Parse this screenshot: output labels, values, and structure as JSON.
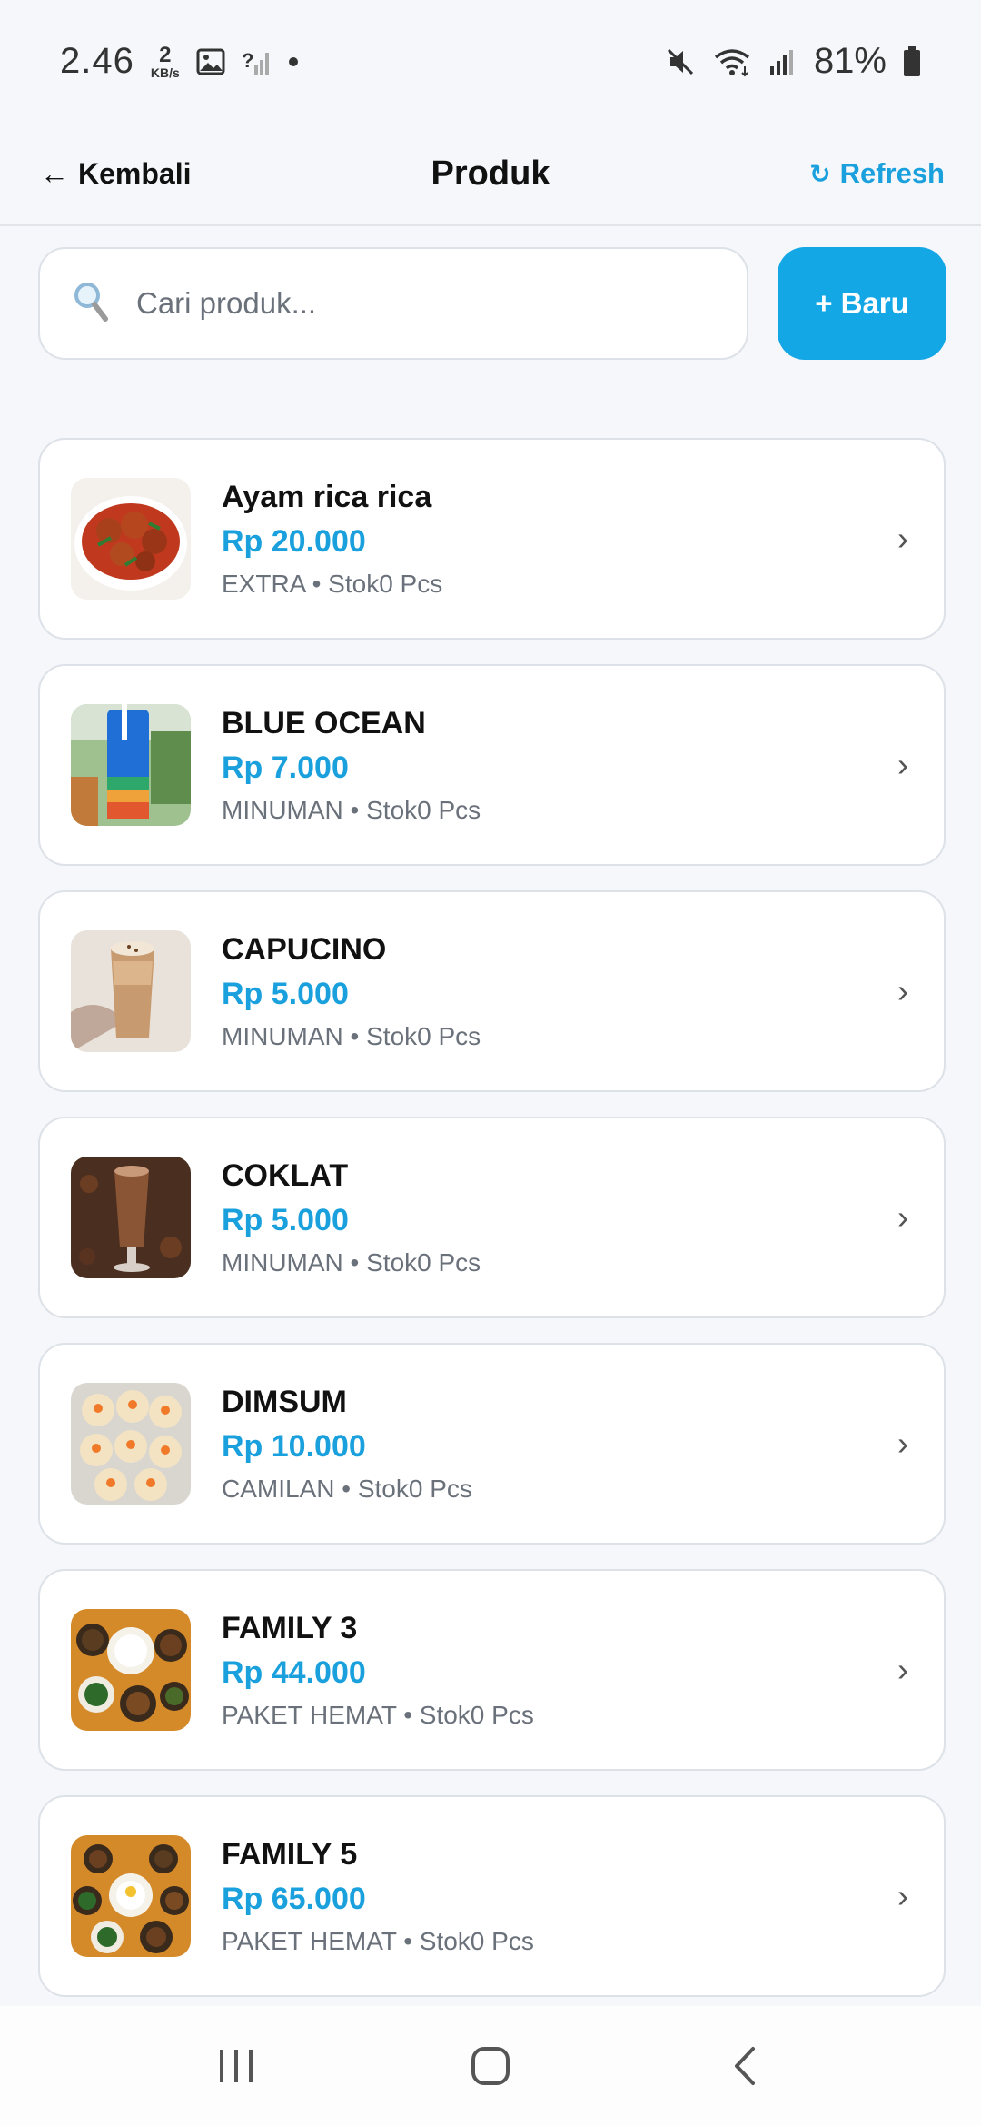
{
  "status_bar": {
    "time": "2.46",
    "net_speed_value": "2",
    "net_speed_unit": "KB/s",
    "battery": "81%"
  },
  "header": {
    "back_label": "Kembali",
    "title": "Produk",
    "refresh_label": "Refresh"
  },
  "search": {
    "placeholder": "Cari produk...",
    "value": "",
    "new_button_label": "+ Baru"
  },
  "products": [
    {
      "name": "Ayam rica rica",
      "price": "Rp 20.000",
      "meta": "EXTRA • Stok0 Pcs",
      "thumb_icon": "food-photo-ayam"
    },
    {
      "name": "BLUE OCEAN",
      "price": "Rp 7.000",
      "meta": "MINUMAN • Stok0 Pcs",
      "thumb_icon": "drink-photo-blue-ocean"
    },
    {
      "name": "CAPUCINO",
      "price": "Rp 5.000",
      "meta": "MINUMAN • Stok0 Pcs",
      "thumb_icon": "drink-photo-capucino"
    },
    {
      "name": "COKLAT",
      "price": "Rp 5.000",
      "meta": "MINUMAN • Stok0 Pcs",
      "thumb_icon": "drink-photo-coklat"
    },
    {
      "name": "DIMSUM",
      "price": "Rp 10.000",
      "meta": "CAMILAN • Stok0 Pcs",
      "thumb_icon": "food-photo-dimsum"
    },
    {
      "name": "FAMILY 3",
      "price": "Rp 44.000",
      "meta": "PAKET HEMAT • Stok0 Pcs",
      "thumb_icon": "food-photo-family-3"
    },
    {
      "name": "FAMILY 5",
      "price": "Rp 65.000",
      "meta": "PAKET HEMAT • Stok0 Pcs",
      "thumb_icon": "food-photo-family-5"
    }
  ],
  "colors": {
    "accent": "#1aa0dc",
    "button": "#14a7e6",
    "background": "#f5f7fa",
    "muted_text": "#6a717a"
  }
}
